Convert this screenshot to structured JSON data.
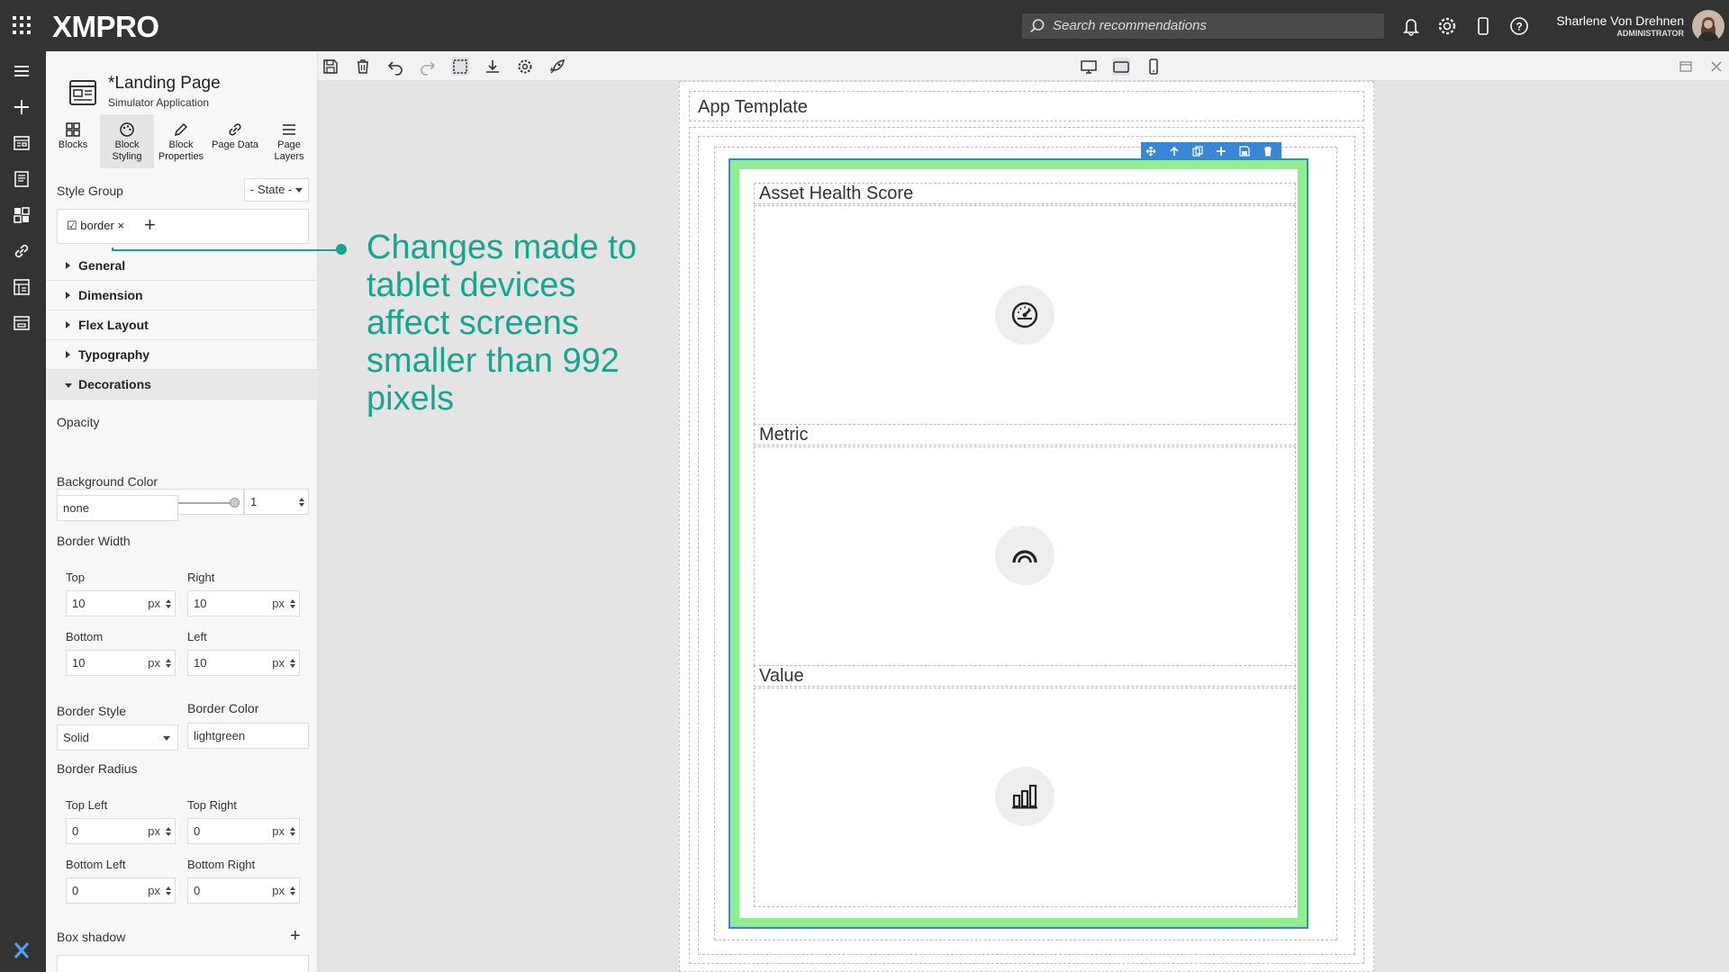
{
  "topbar": {
    "logo": "XMPRO",
    "search_placeholder": "Search recommendations",
    "user_name": "Sharlene Von Drehnen",
    "user_role": "ADMINISTRATOR"
  },
  "page": {
    "title": "*Landing Page",
    "subtitle": "Simulator Application"
  },
  "tabs": [
    {
      "label": "Blocks",
      "icon": "blocks-grid-icon"
    },
    {
      "label": "Block Styling",
      "icon": "palette-icon"
    },
    {
      "label": "Block Properties",
      "icon": "pencil-icon"
    },
    {
      "label": "Page Data",
      "icon": "link-icon"
    },
    {
      "label": "Page Layers",
      "icon": "layers-menu-icon"
    }
  ],
  "style_group": {
    "label": "Style Group",
    "state_select": "- State -",
    "chip": "☑ border ×"
  },
  "sections": [
    "General",
    "Dimension",
    "Flex Layout",
    "Typography",
    "Decorations"
  ],
  "decorations": {
    "opacity_label": "Opacity",
    "opacity_value": "1",
    "bg_color_label": "Background Color",
    "bg_color_value": "none",
    "border_width_label": "Border Width",
    "top_label": "Top",
    "top_value": "10",
    "right_label": "Right",
    "right_value": "10",
    "bottom_label": "Bottom",
    "bottom_value": "10",
    "left_label": "Left",
    "left_value": "10",
    "unit": "px",
    "border_style_label": "Border Style",
    "border_style_value": "Solid",
    "border_color_label": "Border Color",
    "border_color_value": "lightgreen",
    "border_radius_label": "Border Radius",
    "tl_label": "Top Left",
    "tl_value": "0",
    "tr_label": "Top Right",
    "tr_value": "0",
    "bl_label": "Bottom Left",
    "bl_value": "0",
    "br_label": "Bottom Right",
    "br_value": "0",
    "box_shadow_label": "Box shadow"
  },
  "canvas": {
    "app_template": "App Template",
    "widgets": [
      {
        "title": "Asset Health Score",
        "icon": "gauge-icon"
      },
      {
        "title": "Metric",
        "icon": "arc-gauge-icon"
      },
      {
        "title": "Value",
        "icon": "bar-chart-icon"
      }
    ]
  },
  "callout": "Changes made to tablet devices affect screens smaller than 992 pixels",
  "colors": {
    "accent_teal": "#17a592",
    "border_green": "#90ee90",
    "selection_blue": "#3a86d6",
    "chrome_dark": "#333333"
  }
}
